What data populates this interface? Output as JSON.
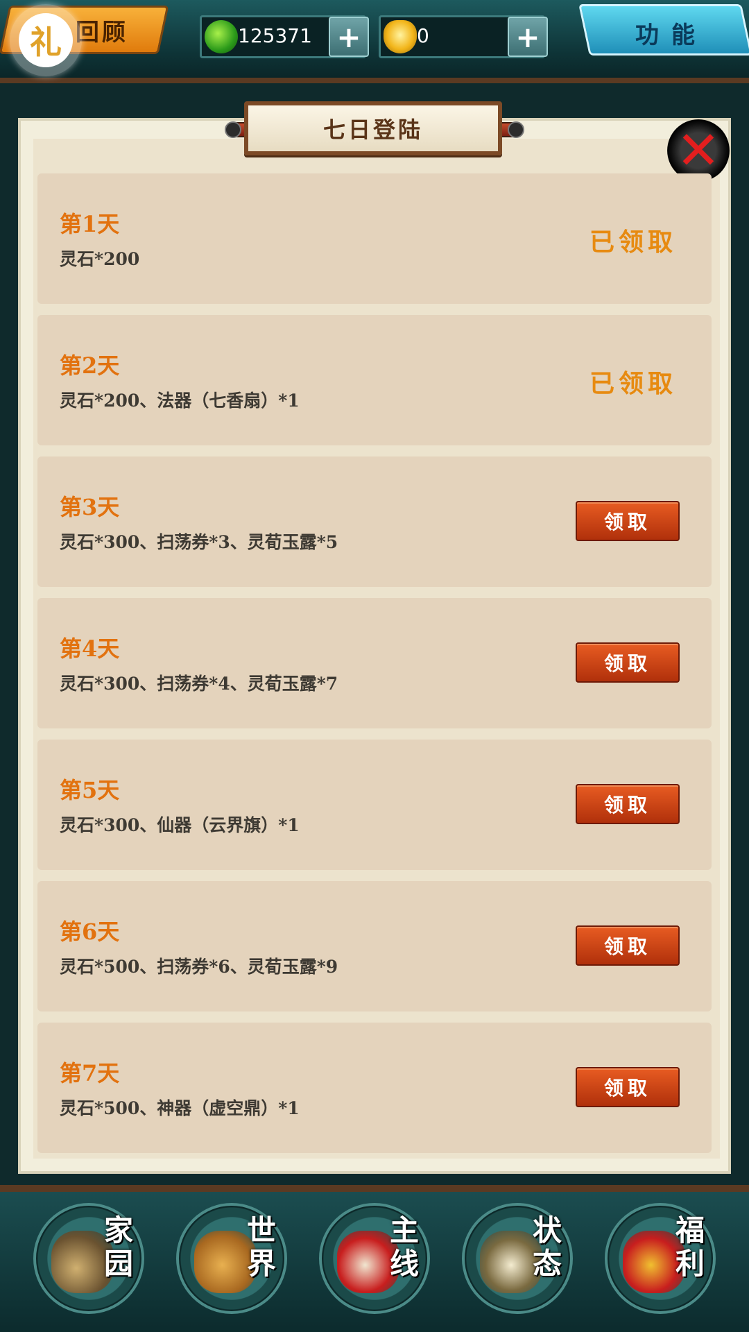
{
  "top_bar": {
    "review_label": "回顾",
    "gift_icon": "礼",
    "spirit_stone_amount": "125371",
    "gold_amount": "0",
    "plus_symbol": "+",
    "function_label": "功能"
  },
  "panel": {
    "title": "七日登陆",
    "close_symbol": "✕",
    "rows": [
      {
        "day": "第1天",
        "reward": "灵石*200",
        "action": "已领取"
      },
      {
        "day": "第2天",
        "reward": "灵石*200、法器（七香扇）*1",
        "action": "已领取"
      },
      {
        "day": "第3天",
        "reward": "灵石*300、扫荡券*3、灵荀玉露*5",
        "action": "领取"
      },
      {
        "day": "第4天",
        "reward": "灵石*300、扫荡券*4、灵荀玉露*7",
        "action": "领取"
      },
      {
        "day": "第5天",
        "reward": "灵石*300、仙器（云界旗）*1",
        "action": "领取"
      },
      {
        "day": "第6天",
        "reward": "灵石*500、扫荡券*6、灵荀玉露*9",
        "action": "领取"
      },
      {
        "day": "第7天",
        "reward": "灵石*500、神器（虚空鼎）*1",
        "action": "领取"
      }
    ]
  },
  "bottom_nav": {
    "items": [
      {
        "label_top": "家",
        "label_bottom": "园"
      },
      {
        "label_top": "世",
        "label_bottom": "界"
      },
      {
        "label_top": "主",
        "label_bottom": "线"
      },
      {
        "label_top": "状",
        "label_bottom": "态"
      },
      {
        "label_top": "福",
        "label_bottom": "利"
      }
    ]
  },
  "colors": {
    "accent_orange": "#e2720f",
    "claim_button": "#c8401a",
    "panel_bg": "#ece3cd"
  }
}
